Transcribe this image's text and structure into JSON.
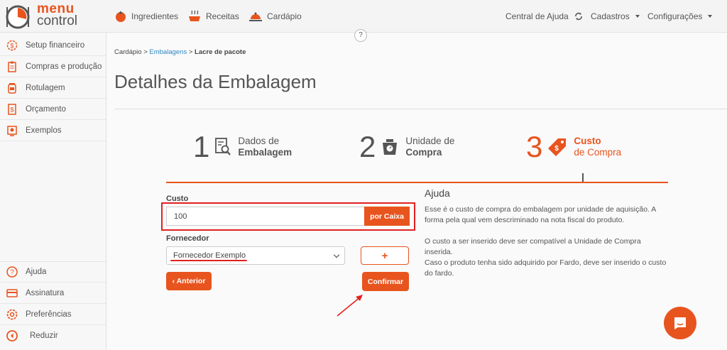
{
  "brand": {
    "line1": "menu",
    "line2": "control"
  },
  "topnav": [
    {
      "label": "Ingredientes",
      "icon": "tomato-icon"
    },
    {
      "label": "Receitas",
      "icon": "pot-icon"
    },
    {
      "label": "Cardápio",
      "icon": "cloche-icon"
    }
  ],
  "right_menu": {
    "help": "Central de Ajuda",
    "cadastros": "Cadastros",
    "config": "Configurações"
  },
  "sidebar": {
    "items": [
      {
        "label": "Setup financeiro",
        "icon": "gear-dollar-icon"
      },
      {
        "label": "Compras e produção",
        "icon": "clipboard-icon"
      },
      {
        "label": "Rotulagem",
        "icon": "jar-icon"
      },
      {
        "label": "Orçamento",
        "icon": "receipt-dollar-icon"
      },
      {
        "label": "Exemplos",
        "icon": "lightbulb-icon"
      }
    ],
    "bottom": [
      {
        "label": "Ajuda",
        "icon": "question-icon"
      },
      {
        "label": "Assinatura",
        "icon": "card-icon"
      },
      {
        "label": "Preferências",
        "icon": "gear-icon"
      },
      {
        "label": "Reduzir",
        "icon": "collapse-icon"
      }
    ]
  },
  "help_bubble": "?",
  "breadcrumb": {
    "root": "Cardápio",
    "sep": " > ",
    "mid": "Embalagens",
    "current": "Lacre de pacote"
  },
  "page_title": "Detalhes da Embalagem",
  "steps": [
    {
      "num": "1",
      "line1": "Dados de",
      "line2": "Embalagem"
    },
    {
      "num": "2",
      "line1": "Unidade de",
      "line2": "Compra"
    },
    {
      "num": "3",
      "line1": "Custo",
      "line2": "de Compra"
    }
  ],
  "form": {
    "custo_label": "Custo",
    "custo_value": "100",
    "unit_addon": "por Caixa",
    "fornecedor_label": "Fornecedor",
    "fornecedor_value": "Fornecedor Exemplo",
    "add_label": "+",
    "prev_label": "‹ Anterior",
    "confirm_label": "Confirmar"
  },
  "help": {
    "title": "Ajuda",
    "p1": "Esse é o custo de compra do embalagem por unidade de aquisição. A forma pela qual vem descriminado na nota fiscal do produto.",
    "p2": "O custo a ser inserido deve ser compatível a Unidade de Compra inserida.",
    "p3": "Caso o produto tenha sido adquirido por Fardo, deve ser inserido o custo do fardo."
  },
  "colors": {
    "accent": "#e8541e",
    "annotation": "#e32020"
  }
}
